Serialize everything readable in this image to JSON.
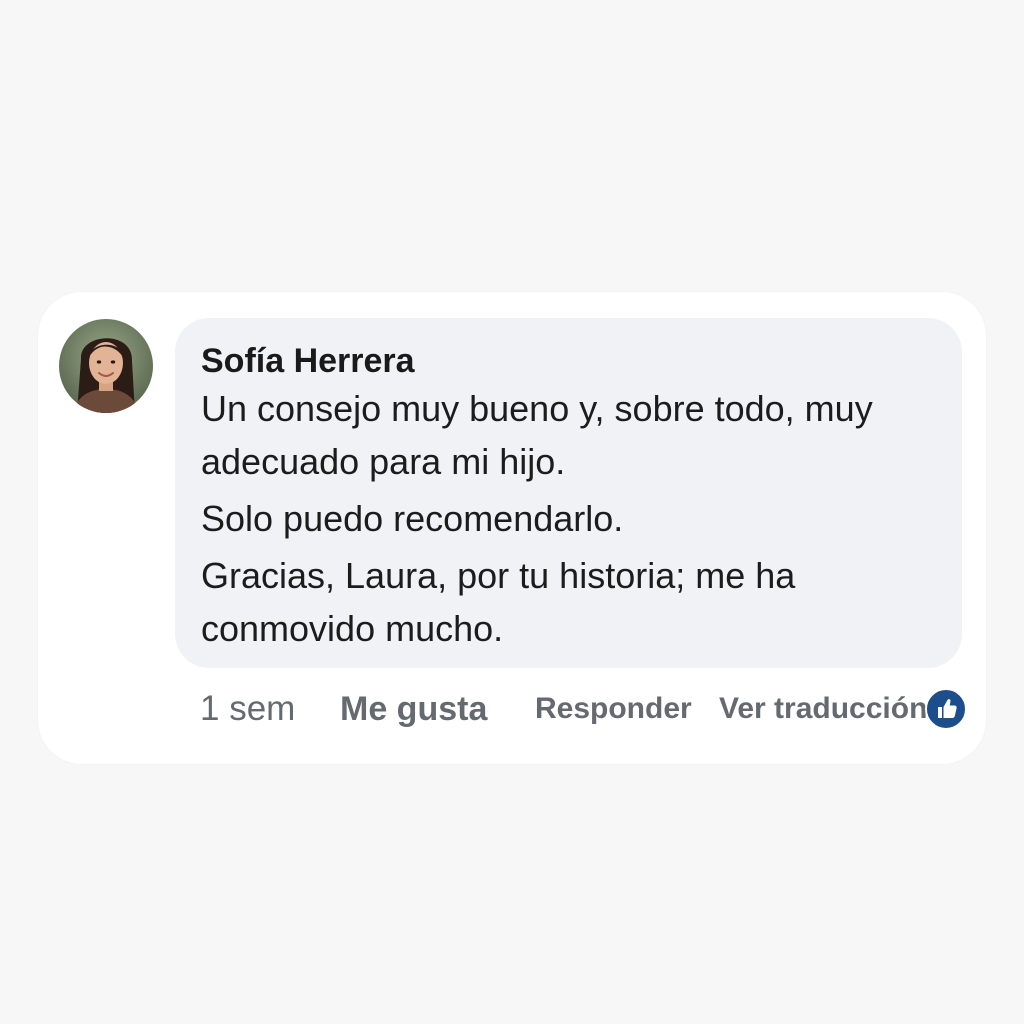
{
  "comment": {
    "author": "Sofía Herrera",
    "paragraphs": [
      "Un consejo muy bueno y, sobre todo, muy adecuado para mi hijo.",
      "Solo puedo recomendarlo.",
      "Gracias, Laura, por tu historia; me ha conmovido mucho."
    ],
    "avatar_icon": "profile-photo"
  },
  "actions": {
    "time": "1 sem",
    "like_label": "Me gusta",
    "reply_label": "Responder",
    "translate_label": "Ver traducción",
    "reaction_icon": "thumbs-up-icon"
  },
  "colors": {
    "background": "#f7f7f8",
    "card": "#ffffff",
    "bubble": "#f0f2f5",
    "action_text": "#656a70",
    "reaction_badge": "#1c4e8c"
  }
}
